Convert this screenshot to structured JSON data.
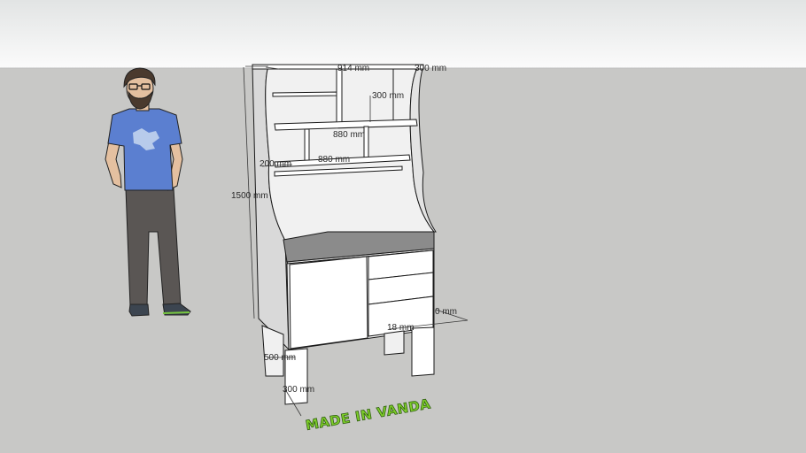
{
  "dimensions": {
    "top_width": "914 mm",
    "top_depth": "300 mm",
    "upper_shelf_height": "300 mm",
    "shelf_width_1": "880 mm",
    "shelf_width_2": "880 mm",
    "shelf_gap": "200 mm",
    "total_height": "1500 mm",
    "right_depth": "0 mm",
    "board_thickness": "18 mm",
    "leg_height": "500 mm",
    "leg_depth": "300 mm"
  },
  "brand_text": "MADE IN VANDA",
  "colors": {
    "sky_top": "#e4e6e6",
    "sky_bottom": "#fafafa",
    "ground": "#c8c8c6",
    "board_face": "#ffffff",
    "board_side": "#d9d9d9",
    "counter_top": "#8b8b8b",
    "edge": "#1a1a1a",
    "brand_fill": "#7fcf2a",
    "shirt": "#5b7fd0"
  }
}
